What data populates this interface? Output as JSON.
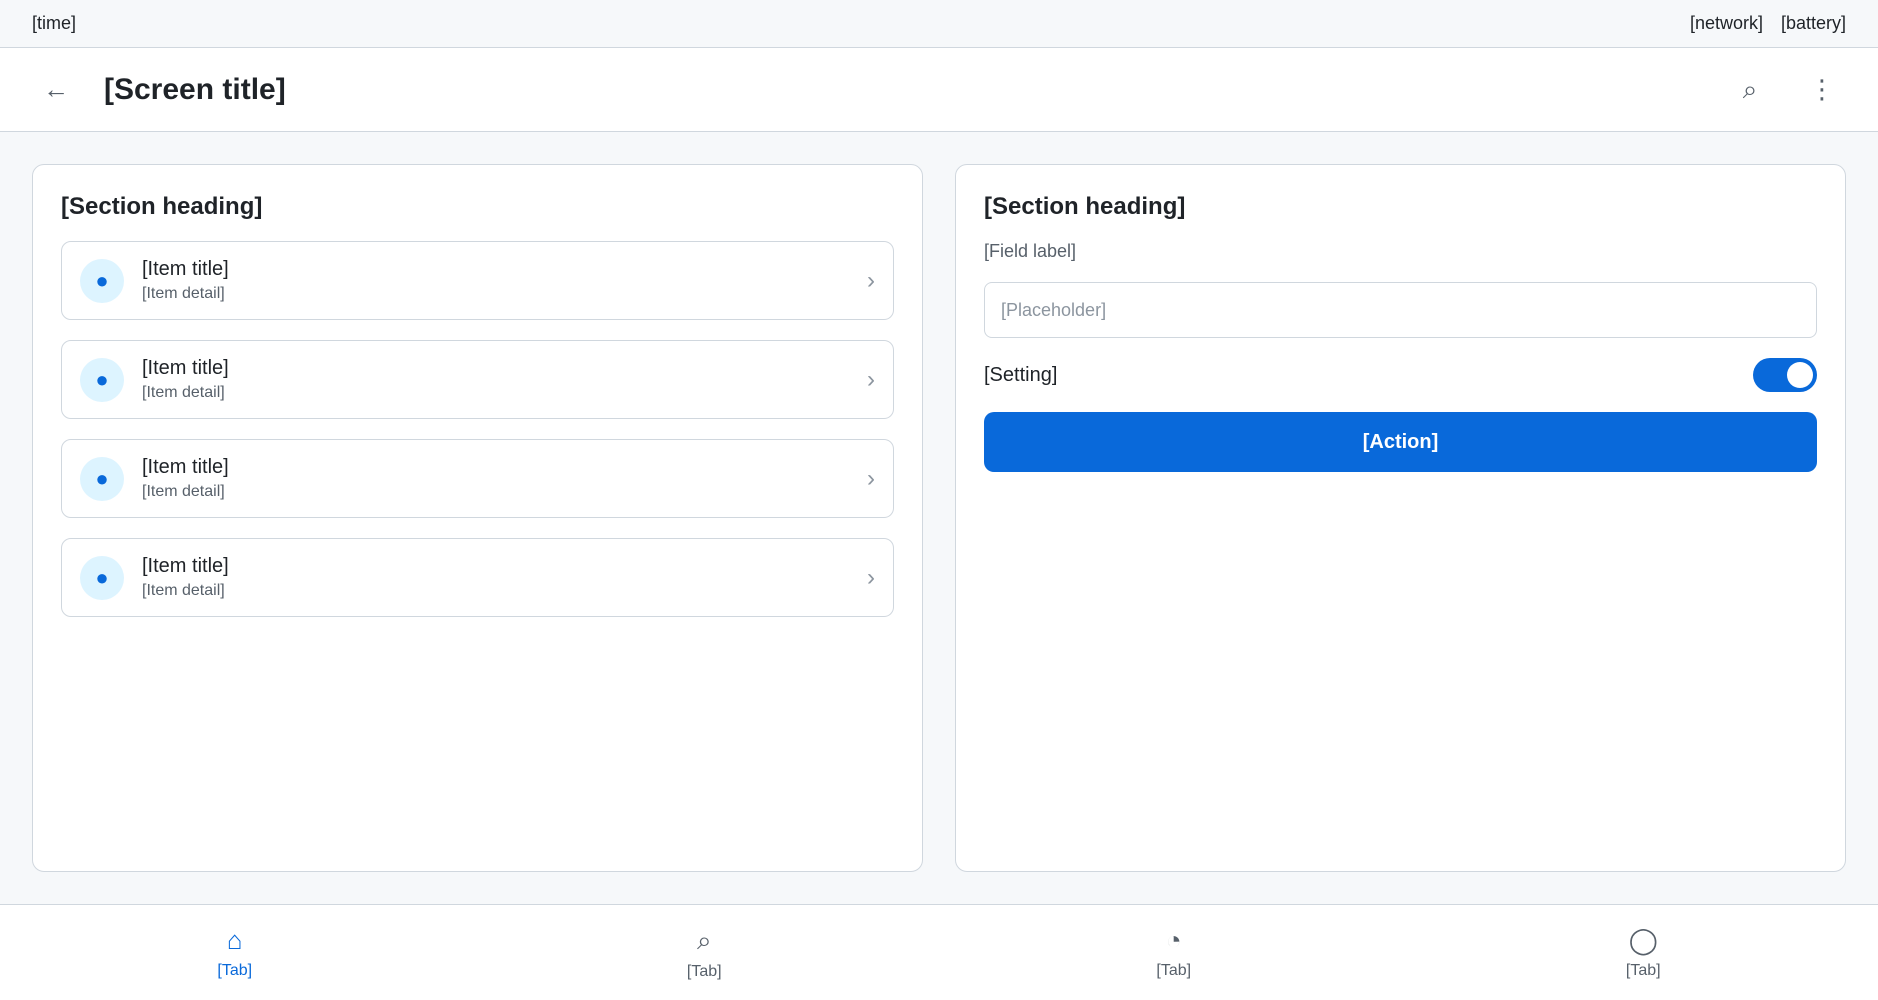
{
  "status": {
    "time": "[time]",
    "network": "[network]",
    "battery": "[battery]"
  },
  "app_bar": {
    "title": "[Screen title]"
  },
  "list_section": {
    "heading": "[Section heading]",
    "items": [
      {
        "title": "[Item title]",
        "subtitle": "[Item detail]"
      },
      {
        "title": "[Item title]",
        "subtitle": "[Item detail]"
      },
      {
        "title": "[Item title]",
        "subtitle": "[Item detail]"
      },
      {
        "title": "[Item title]",
        "subtitle": "[Item detail]"
      }
    ]
  },
  "form_section": {
    "heading": "[Section heading]",
    "field_label": "[Field label]",
    "field_placeholder": "[Placeholder]",
    "toggle_label": "[Setting]",
    "submit_label": "[Action]"
  },
  "bottom_nav": {
    "items": [
      "[Tab]",
      "[Tab]",
      "[Tab]",
      "[Tab]"
    ]
  },
  "colors": {
    "accent": "#0969da",
    "background": "#f6f8fa"
  }
}
